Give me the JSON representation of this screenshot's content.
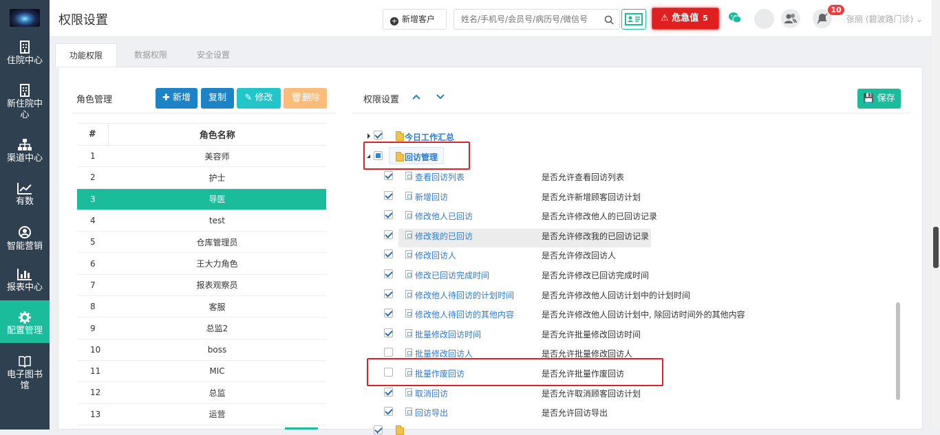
{
  "sidebar": {
    "items": [
      {
        "label": "住院中心",
        "icon": "hospital-icon"
      },
      {
        "label": "新住院中心",
        "icon": "hospital-icon"
      },
      {
        "label": "渠道中心",
        "icon": "sitemap-icon"
      },
      {
        "label": "有数",
        "icon": "line-chart-icon"
      },
      {
        "label": "智能营销",
        "icon": "marketing-icon"
      },
      {
        "label": "报表中心",
        "icon": "bar-chart-icon"
      },
      {
        "label": "配置管理",
        "icon": "gear-icon",
        "active": true
      },
      {
        "label": "电子图书馆",
        "icon": "book-icon"
      }
    ]
  },
  "header": {
    "title": "权限设置",
    "new_customer_label": "新增客户",
    "search_placeholder": "姓名/手机号/会员号/病历号/微信号",
    "alert_label": "危急值",
    "alert_count": "5",
    "notification_count": "10",
    "user_name": "张丽 (碧波路门诊)"
  },
  "tabs": [
    {
      "label": "功能权限",
      "active": true
    },
    {
      "label": "数据权限",
      "active": false
    },
    {
      "label": "安全设置",
      "active": false
    }
  ],
  "roles_panel": {
    "title": "角色管理",
    "buttons": {
      "add": "新增",
      "copy": "复制",
      "edit": "修改",
      "delete": "删除"
    },
    "columns": [
      "#",
      "角色名称"
    ],
    "rows": [
      {
        "num": "1",
        "name": "美容师"
      },
      {
        "num": "2",
        "name": "护士"
      },
      {
        "num": "3",
        "name": "导医",
        "selected": true
      },
      {
        "num": "4",
        "name": "test"
      },
      {
        "num": "5",
        "name": "仓库管理员"
      },
      {
        "num": "6",
        "name": "王大力角色"
      },
      {
        "num": "7",
        "name": "报表观察员"
      },
      {
        "num": "8",
        "name": "客服"
      },
      {
        "num": "9",
        "name": "总监2"
      },
      {
        "num": "10",
        "name": "boss"
      },
      {
        "num": "11",
        "name": "MIC"
      },
      {
        "num": "12",
        "name": "总监"
      },
      {
        "num": "13",
        "name": "运营"
      }
    ]
  },
  "permission_panel": {
    "title": "权限设置",
    "save_label": "保存",
    "groups": [
      {
        "label": "今日工作汇总",
        "checked": "checked",
        "expanded": false
      },
      {
        "label": "回访管理",
        "checked": "partial",
        "expanded": true
      }
    ],
    "items": [
      {
        "label": "查看回访列表",
        "desc": "是否允许查看回访列表",
        "checked": true
      },
      {
        "label": "新增回访",
        "desc": "是否允许新增顾客回访计划",
        "checked": true
      },
      {
        "label": "修改他人已回访",
        "desc": "是否允许修改他人的已回访记录",
        "checked": true
      },
      {
        "label": "修改我的已回访",
        "desc": "是否允许修改我的已回访记录",
        "checked": true,
        "hover": true
      },
      {
        "label": "修改回访人",
        "desc": "是否允许修改回访人",
        "checked": true
      },
      {
        "label": "修改已回访完成时间",
        "desc": "是否允许修改已回访完成时间",
        "checked": true
      },
      {
        "label": "修改他人待回访的计划时间",
        "desc": "是否允许修改他人回访计划中的计划时间",
        "checked": true
      },
      {
        "label": "修改他人待回访的其他内容",
        "desc": "是否允许修改他人回访计划中, 除回访时间外的其他内容",
        "checked": true
      },
      {
        "label": "批量修改回访时间",
        "desc": "是否允许批量修改回访时间",
        "checked": true
      },
      {
        "label": "批量修改回访人",
        "desc": "是否允许批量修改回访人",
        "checked": false
      },
      {
        "label": "批量作废回访",
        "desc": "是否允许批量作废回访",
        "checked": false
      },
      {
        "label": "取消回访",
        "desc": "是否允许取消顾客回访计划",
        "checked": true
      },
      {
        "label": "回访导出",
        "desc": "是否允许回访导出",
        "checked": true
      }
    ]
  },
  "colors": {
    "sidebar": "#2f4050",
    "accent": "#1abc9c",
    "blue": "#1c84c6",
    "orange": "#f8ac59",
    "danger": "#e02020",
    "link": "#2b7bd5"
  }
}
